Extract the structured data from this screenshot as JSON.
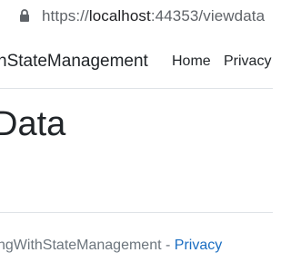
{
  "browser": {
    "url_protocol": "https://",
    "url_host": "localhost",
    "url_rest": ":44353/viewdata",
    "lock_icon": "lock-icon"
  },
  "navbar": {
    "brand": "hStateManagement",
    "links": [
      {
        "label": "Home"
      },
      {
        "label": "Privacy"
      }
    ]
  },
  "main": {
    "heading": "Data"
  },
  "footer": {
    "prefix": "ngWithStateManagement - ",
    "link": "Privacy"
  },
  "colors": {
    "link": "#1b6ec2",
    "text": "#212529",
    "muted": "#6c757d",
    "border": "#dee2e6"
  }
}
